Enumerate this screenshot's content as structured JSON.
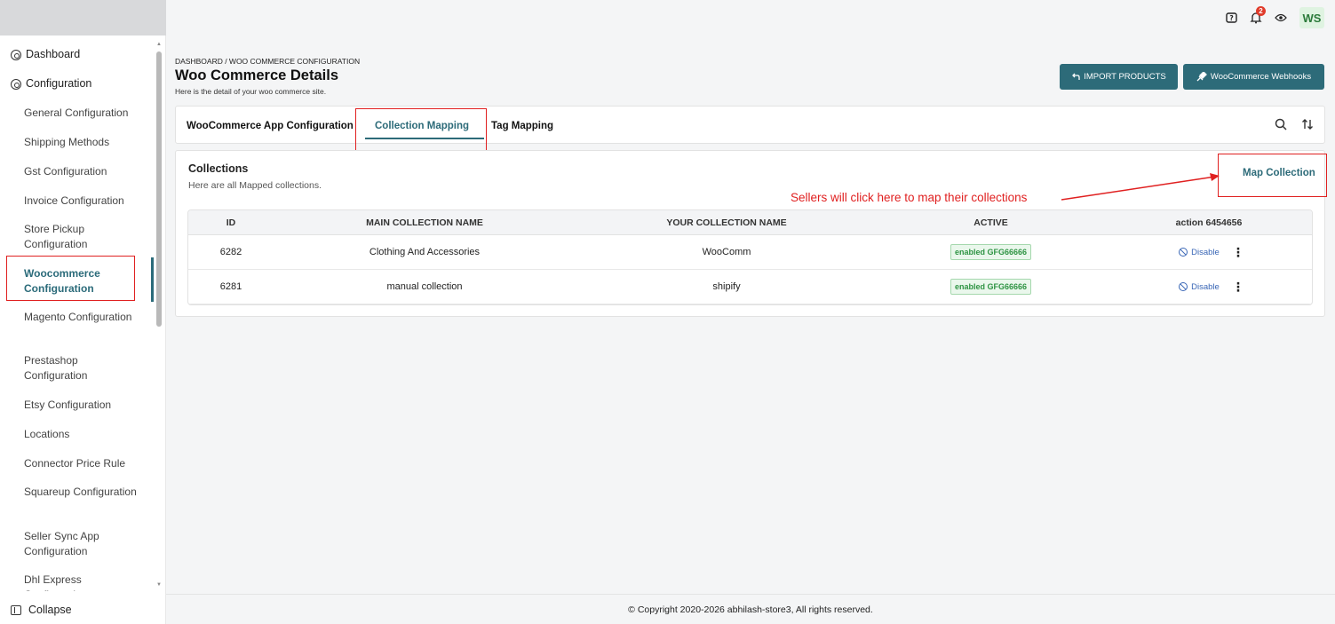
{
  "topbar": {
    "notification_count": "2",
    "avatar_initials": "WS"
  },
  "sidebar": {
    "items": [
      {
        "label": "Dashboard"
      },
      {
        "label": "Configuration"
      },
      {
        "label": "General Configuration"
      },
      {
        "label": "Shipping Methods"
      },
      {
        "label": "Gst Configuration"
      },
      {
        "label": "Invoice Configuration"
      },
      {
        "label": "Store Pickup Configuration"
      },
      {
        "label": "Woocommerce Configuration"
      },
      {
        "label": "Magento Configuration"
      },
      {
        "label": "Prestashop Configuration"
      },
      {
        "label": "Etsy Configuration"
      },
      {
        "label": "Locations"
      },
      {
        "label": "Connector Price Rule"
      },
      {
        "label": "Squareup Configuration"
      },
      {
        "label": "Seller Sync App Configuration"
      },
      {
        "label": "Dhl Express Configuration"
      }
    ],
    "collapse_label": "Collapse"
  },
  "header": {
    "breadcrumb": "DASHBOARD / WOO COMMERCE CONFIGURATION",
    "title": "Woo Commerce Details",
    "subtitle": "Here is the detail of your woo commerce site.",
    "import_button": "IMPORT PRODUCTS",
    "webhooks_button": "WooCommerce Webhooks"
  },
  "tabs": [
    {
      "label": "WooCommerce App Configuration"
    },
    {
      "label": "Collection Mapping"
    },
    {
      "label": "Tag Mapping"
    }
  ],
  "collections": {
    "title": "Collections",
    "subtitle": "Here are all Mapped collections.",
    "map_link": "Map Collection",
    "annotation": "Sellers will click here to map their collections",
    "columns": [
      "ID",
      "MAIN COLLECTION NAME",
      "YOUR COLLECTION NAME",
      "ACTIVE",
      "action 6454656"
    ],
    "rows": [
      {
        "id": "6282",
        "main": "Clothing And Accessories",
        "yours": "WooComm",
        "active": "enabled GFG66666",
        "action": "Disable"
      },
      {
        "id": "6281",
        "main": "manual collection",
        "yours": "shipify",
        "active": "enabled GFG66666",
        "action": "Disable"
      }
    ]
  },
  "footer": {
    "copyright": "© Copyright 2020-2026 abhilash-store3, All rights reserved."
  },
  "colors": {
    "accent": "#2d6b79",
    "annotation": "#e02020",
    "badge_green": "#2f9444",
    "link_blue": "#3a67b6"
  }
}
